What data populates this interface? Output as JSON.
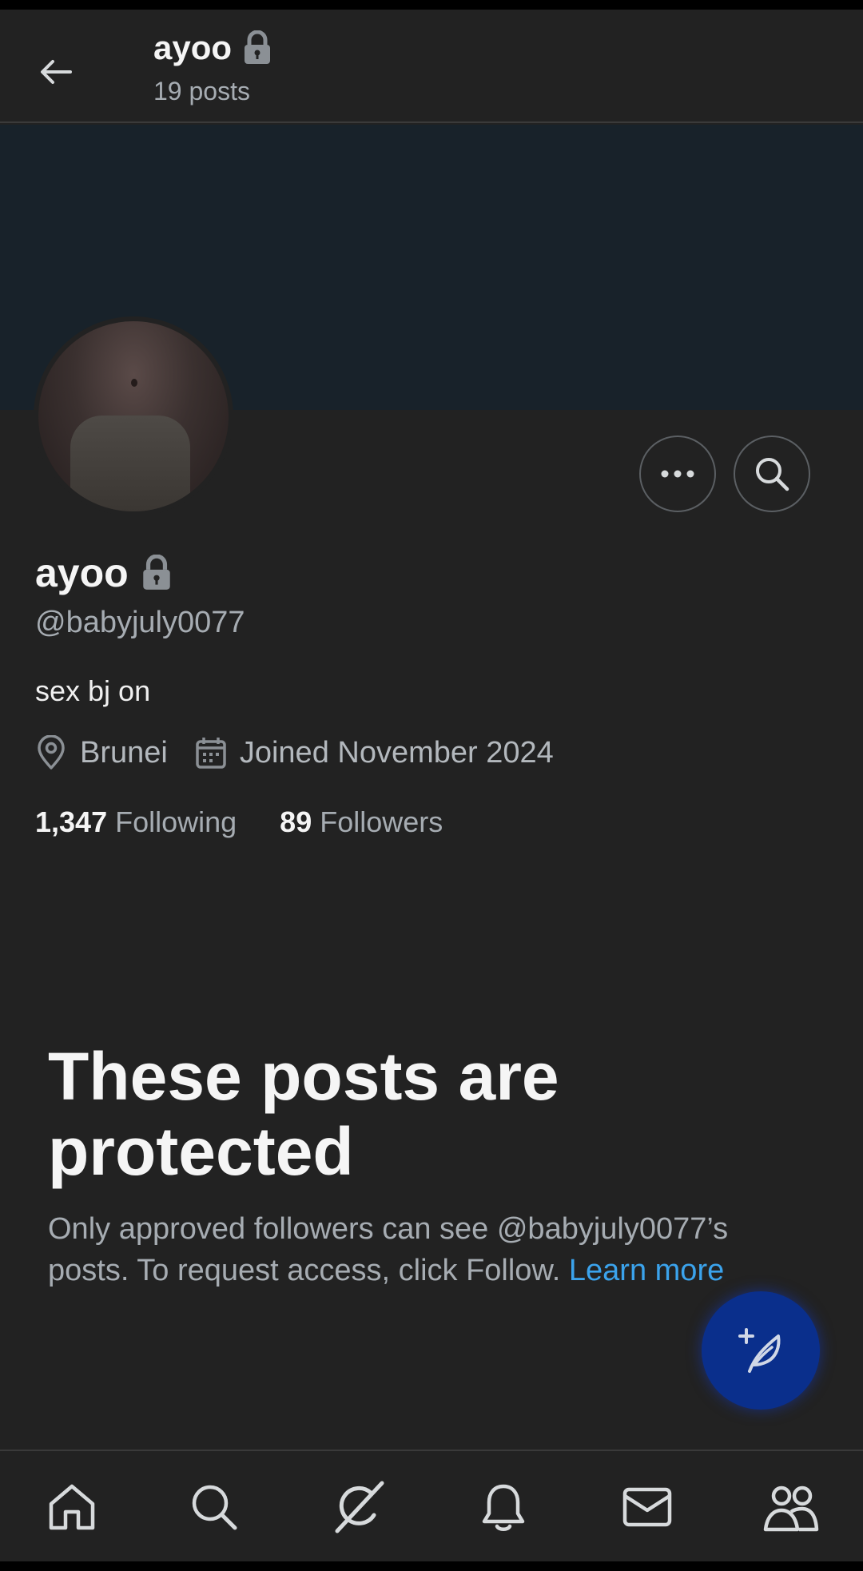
{
  "colors": {
    "background": "#222222",
    "banner": "#18222a",
    "accent_link": "#3ba3ec",
    "fab": "#0a2f8c",
    "text_primary": "#f5f5f5",
    "text_secondary": "#a6acb2"
  },
  "header": {
    "back_icon": "arrow-left-icon",
    "name": "ayoo",
    "lock_icon": "lock-icon",
    "posts_count": "19 posts"
  },
  "profile": {
    "name": "ayoo",
    "handle": "@babyjuly0077",
    "bio": "sex bj on",
    "location": "Brunei",
    "joined": "Joined November 2024",
    "following_count": "1,347",
    "following_label": "Following",
    "followers_count": "89",
    "followers_label": "Followers"
  },
  "actions": {
    "more_icon": "more-horizontal-icon",
    "search_icon": "search-icon"
  },
  "protected": {
    "title": "These posts are protected",
    "description": "Only approved followers can see @babyjuly0077’s posts. To request access, click Follow.",
    "learn_more": "Learn more"
  },
  "fab": {
    "icon": "compose-post-icon"
  },
  "bottom_nav": {
    "items": [
      {
        "icon": "home-icon"
      },
      {
        "icon": "search-icon"
      },
      {
        "icon": "grok-icon"
      },
      {
        "icon": "bell-icon"
      },
      {
        "icon": "mail-icon"
      },
      {
        "icon": "communities-icon"
      }
    ]
  }
}
